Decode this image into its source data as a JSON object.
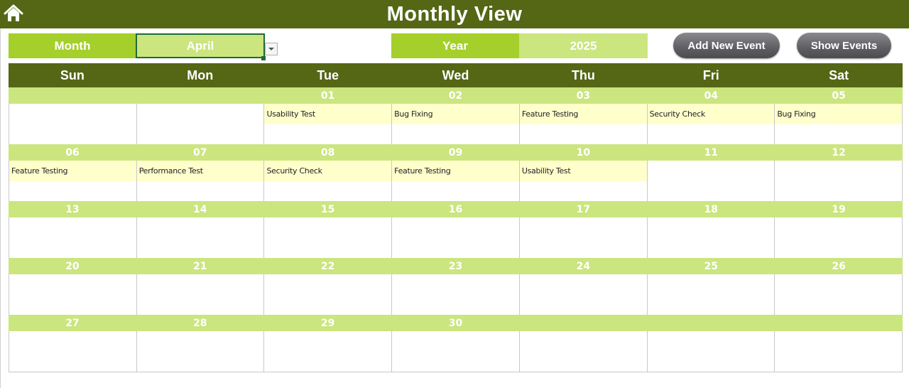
{
  "header": {
    "title": "Monthly View",
    "home_icon": "home-icon"
  },
  "controls": {
    "month_label": "Month",
    "month_value": "April",
    "year_label": "Year",
    "year_value": "2025",
    "add_event_label": "Add New Event",
    "show_events_label": "Show Events"
  },
  "colors": {
    "dark_green": "#556615",
    "lime": "#a5cf2a",
    "light_lime": "#cbe57f",
    "event_bg": "#ffffcc"
  },
  "weekdays": [
    "Sun",
    "Mon",
    "Tue",
    "Wed",
    "Thu",
    "Fri",
    "Sat"
  ],
  "weeks": [
    {
      "days": [
        {
          "date": "",
          "event": ""
        },
        {
          "date": "",
          "event": ""
        },
        {
          "date": "01",
          "event": "Usability Test"
        },
        {
          "date": "02",
          "event": "Bug Fixing"
        },
        {
          "date": "03",
          "event": "Feature Testing"
        },
        {
          "date": "04",
          "event": "Security Check"
        },
        {
          "date": "05",
          "event": "Bug Fixing"
        }
      ]
    },
    {
      "days": [
        {
          "date": "06",
          "event": "Feature Testing"
        },
        {
          "date": "07",
          "event": "Performance Test"
        },
        {
          "date": "08",
          "event": "Security Check"
        },
        {
          "date": "09",
          "event": "Feature Testing"
        },
        {
          "date": "10",
          "event": "Usability Test"
        },
        {
          "date": "11",
          "event": ""
        },
        {
          "date": "12",
          "event": ""
        }
      ]
    },
    {
      "days": [
        {
          "date": "13",
          "event": ""
        },
        {
          "date": "14",
          "event": ""
        },
        {
          "date": "15",
          "event": ""
        },
        {
          "date": "16",
          "event": ""
        },
        {
          "date": "17",
          "event": ""
        },
        {
          "date": "18",
          "event": ""
        },
        {
          "date": "19",
          "event": ""
        }
      ]
    },
    {
      "days": [
        {
          "date": "20",
          "event": ""
        },
        {
          "date": "21",
          "event": ""
        },
        {
          "date": "22",
          "event": ""
        },
        {
          "date": "23",
          "event": ""
        },
        {
          "date": "24",
          "event": ""
        },
        {
          "date": "25",
          "event": ""
        },
        {
          "date": "26",
          "event": ""
        }
      ]
    },
    {
      "days": [
        {
          "date": "27",
          "event": ""
        },
        {
          "date": "28",
          "event": ""
        },
        {
          "date": "29",
          "event": ""
        },
        {
          "date": "30",
          "event": ""
        },
        {
          "date": "",
          "event": ""
        },
        {
          "date": "",
          "event": ""
        },
        {
          "date": "",
          "event": ""
        }
      ]
    }
  ]
}
